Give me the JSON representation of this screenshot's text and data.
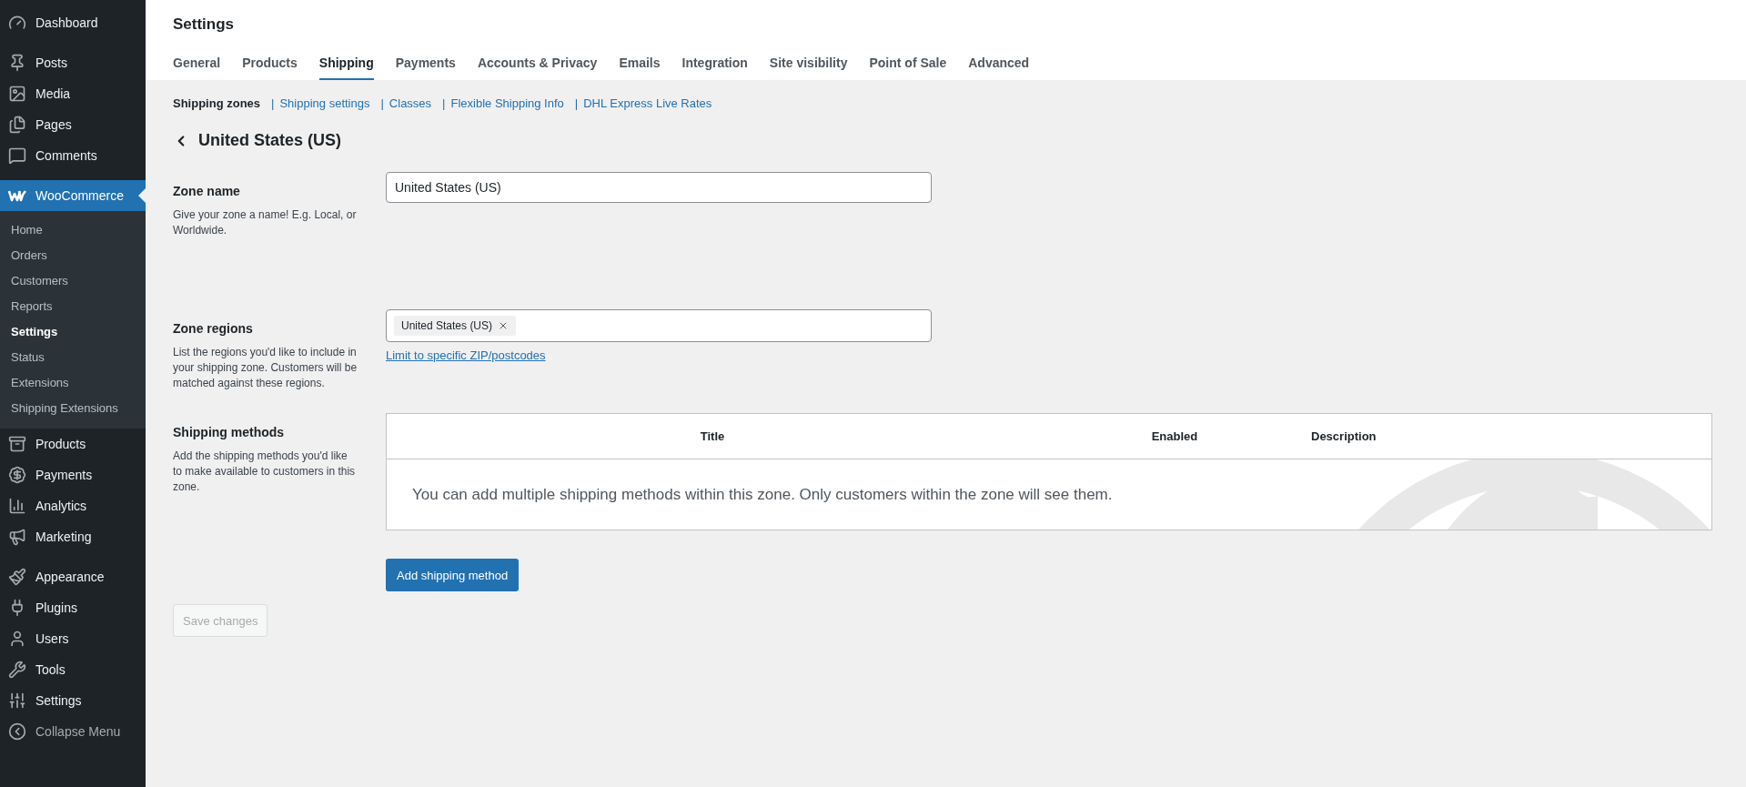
{
  "sidebar": {
    "groups": [
      [
        {
          "label": "Dashboard",
          "selected": false
        }
      ],
      [
        {
          "label": "Posts",
          "selected": false
        },
        {
          "label": "Media",
          "selected": false
        },
        {
          "label": "Pages",
          "selected": false
        },
        {
          "label": "Comments",
          "selected": false
        }
      ],
      [
        {
          "label": "WooCommerce",
          "selected": true,
          "children": [
            {
              "label": "Home",
              "selected": false
            },
            {
              "label": "Orders",
              "selected": false
            },
            {
              "label": "Customers",
              "selected": false
            },
            {
              "label": "Reports",
              "selected": false
            },
            {
              "label": "Settings",
              "selected": true
            },
            {
              "label": "Status",
              "selected": false
            },
            {
              "label": "Extensions",
              "selected": false
            },
            {
              "label": "Shipping Extensions",
              "selected": false
            }
          ]
        },
        {
          "label": "Products",
          "selected": false
        },
        {
          "label": "Payments",
          "selected": false
        },
        {
          "label": "Analytics",
          "selected": false
        },
        {
          "label": "Marketing",
          "selected": false
        }
      ],
      [
        {
          "label": "Appearance",
          "selected": false
        },
        {
          "label": "Plugins",
          "selected": false
        },
        {
          "label": "Users",
          "selected": false
        },
        {
          "label": "Tools",
          "selected": false
        },
        {
          "label": "Settings",
          "selected": false
        },
        {
          "label": "Collapse Menu",
          "selected": false
        }
      ]
    ]
  },
  "page": {
    "title": "Settings"
  },
  "tabs": [
    {
      "label": "General",
      "selected": false
    },
    {
      "label": "Products",
      "selected": false
    },
    {
      "label": "Shipping",
      "selected": true
    },
    {
      "label": "Payments",
      "selected": false
    },
    {
      "label": "Accounts & Privacy",
      "selected": false
    },
    {
      "label": "Emails",
      "selected": false
    },
    {
      "label": "Integration",
      "selected": false
    },
    {
      "label": "Site visibility",
      "selected": false
    },
    {
      "label": "Point of Sale",
      "selected": false
    },
    {
      "label": "Advanced",
      "selected": false
    }
  ],
  "subnav": [
    {
      "label": "Shipping zones",
      "selected": true
    },
    {
      "separator": "|",
      "label": "Shipping settings",
      "selected": false
    },
    {
      "separator": "|",
      "label": "Classes",
      "selected": false
    },
    {
      "separator": "|",
      "label": "Flexible Shipping Info",
      "selected": false
    },
    {
      "separator": "|",
      "label": "DHL Express Live Rates",
      "selected": false
    }
  ],
  "zone_heading": "United States (US)",
  "zone_name": {
    "label": "Zone name",
    "description": "Give your zone a name! E.g. Local, or Worldwide.",
    "value": "United States (US)"
  },
  "zone_regions": {
    "label": "Zone regions",
    "description": "List the regions you'd like to include in your shipping zone. Customers will be matched against these regions.",
    "regions": [
      "United States (US)"
    ],
    "link": "Limit to specific ZIP/postcodes"
  },
  "shipping_methods": {
    "label": "Shipping methods",
    "description": "Add the shipping methods you'd like to make available to customers in this zone.",
    "columns": [
      "Title",
      "Enabled",
      "Description"
    ],
    "empty_message": "You can add multiple shipping methods within this zone. Only customers within the zone will see them.",
    "add_button": "Add shipping method"
  },
  "save_button": {
    "label": "Save changes",
    "disabled": true
  }
}
